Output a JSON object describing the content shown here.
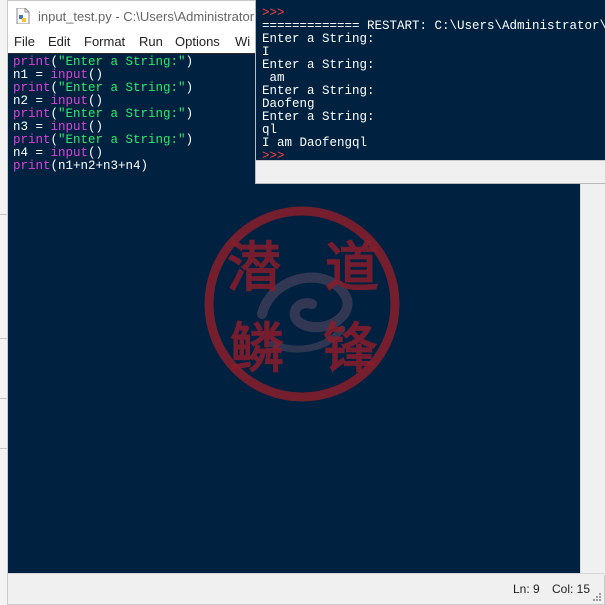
{
  "editor": {
    "title": "input_test.py - C:\\Users\\Administrator",
    "menu": [
      "File",
      "Edit",
      "Format",
      "Run",
      "Options",
      "Wi"
    ],
    "code": [
      [
        {
          "t": "kw",
          "v": "print"
        },
        {
          "t": "plain",
          "v": "("
        },
        {
          "t": "str",
          "v": "\"Enter a String:\""
        },
        {
          "t": "plain",
          "v": ")"
        }
      ],
      [
        {
          "t": "plain",
          "v": "n1 = "
        },
        {
          "t": "kw",
          "v": "input"
        },
        {
          "t": "plain",
          "v": "()"
        }
      ],
      [
        {
          "t": "kw",
          "v": "print"
        },
        {
          "t": "plain",
          "v": "("
        },
        {
          "t": "str",
          "v": "\"Enter a String:\""
        },
        {
          "t": "plain",
          "v": ")"
        }
      ],
      [
        {
          "t": "plain",
          "v": "n2 = "
        },
        {
          "t": "kw",
          "v": "input"
        },
        {
          "t": "plain",
          "v": "()"
        }
      ],
      [
        {
          "t": "kw",
          "v": "print"
        },
        {
          "t": "plain",
          "v": "("
        },
        {
          "t": "str",
          "v": "\"Enter a String:\""
        },
        {
          "t": "plain",
          "v": ")"
        }
      ],
      [
        {
          "t": "plain",
          "v": "n3 = "
        },
        {
          "t": "kw",
          "v": "input"
        },
        {
          "t": "plain",
          "v": "()"
        }
      ],
      [
        {
          "t": "kw",
          "v": "print"
        },
        {
          "t": "plain",
          "v": "("
        },
        {
          "t": "str",
          "v": "\"Enter a String:\""
        },
        {
          "t": "plain",
          "v": ")"
        }
      ],
      [
        {
          "t": "plain",
          "v": "n4 = "
        },
        {
          "t": "kw",
          "v": "input"
        },
        {
          "t": "plain",
          "v": "()"
        }
      ],
      [
        {
          "t": "kw",
          "v": "print"
        },
        {
          "t": "plain",
          "v": "(n1+n2+n3+n4)"
        }
      ]
    ],
    "status": {
      "line": "Ln: 9",
      "col": "Col: 15"
    }
  },
  "shell": {
    "lines": [
      {
        "t": "out",
        "v": "                    "
      },
      {
        "t": "prompt",
        "v": ">>>"
      },
      {
        "t": "out",
        "v": "============= RESTART: C:\\Users\\Administrator\\Des"
      },
      {
        "t": "out",
        "v": "Enter a String:"
      },
      {
        "t": "inp",
        "v": "I"
      },
      {
        "t": "out",
        "v": "Enter a String:"
      },
      {
        "t": "inp",
        "v": " am"
      },
      {
        "t": "out",
        "v": "Enter a String:"
      },
      {
        "t": "inp",
        "v": "Daofeng"
      },
      {
        "t": "out",
        "v": "Enter a String:"
      },
      {
        "t": "inp",
        "v": "ql"
      },
      {
        "t": "out",
        "v": "I am Daofengql"
      },
      {
        "t": "prompt",
        "v": ">>>"
      }
    ]
  },
  "watermark": {
    "chars": [
      "潜",
      "道",
      "鳞",
      "锋"
    ],
    "color": "#8a1d2b"
  },
  "colors": {
    "editor_bg": "#002240",
    "keyword": "#e13fd8",
    "string": "#2ee86d",
    "prompt": "#ff4040"
  }
}
